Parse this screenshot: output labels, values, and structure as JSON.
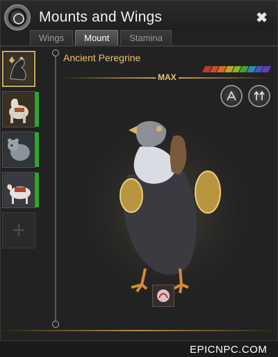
{
  "window": {
    "title": "Mounts and Wings"
  },
  "tabs": [
    {
      "label": "Wings",
      "active": false
    },
    {
      "label": "Mount",
      "active": true
    },
    {
      "label": "Stamina",
      "active": false
    }
  ],
  "mount_list": [
    {
      "name": "ancient-peregrine",
      "icon": "griffin-icon",
      "active": true
    },
    {
      "name": "white-horse",
      "icon": "horse-icon",
      "active": false
    },
    {
      "name": "gray-bear",
      "icon": "bear-icon",
      "active": false
    },
    {
      "name": "saddled-mount",
      "icon": "cow-icon",
      "active": false
    }
  ],
  "add_slot": {
    "icon": "plus-icon"
  },
  "selected": {
    "name": "Ancient Peregrine",
    "level_label": "MAX",
    "grade_colors": [
      "#b83a2a",
      "#c64e2a",
      "#d06f2a",
      "#c8a02a",
      "#8ab22a",
      "#3fa23a",
      "#2a8ab8",
      "#3a5ab8",
      "#6a3ab8"
    ]
  },
  "skills": [
    {
      "icon": "wing-skill-icon"
    },
    {
      "icon": "dual-arrow-skill-icon"
    }
  ],
  "summon": {
    "icon": "summon-item-icon"
  },
  "watermark": "EPICNPC.COM"
}
